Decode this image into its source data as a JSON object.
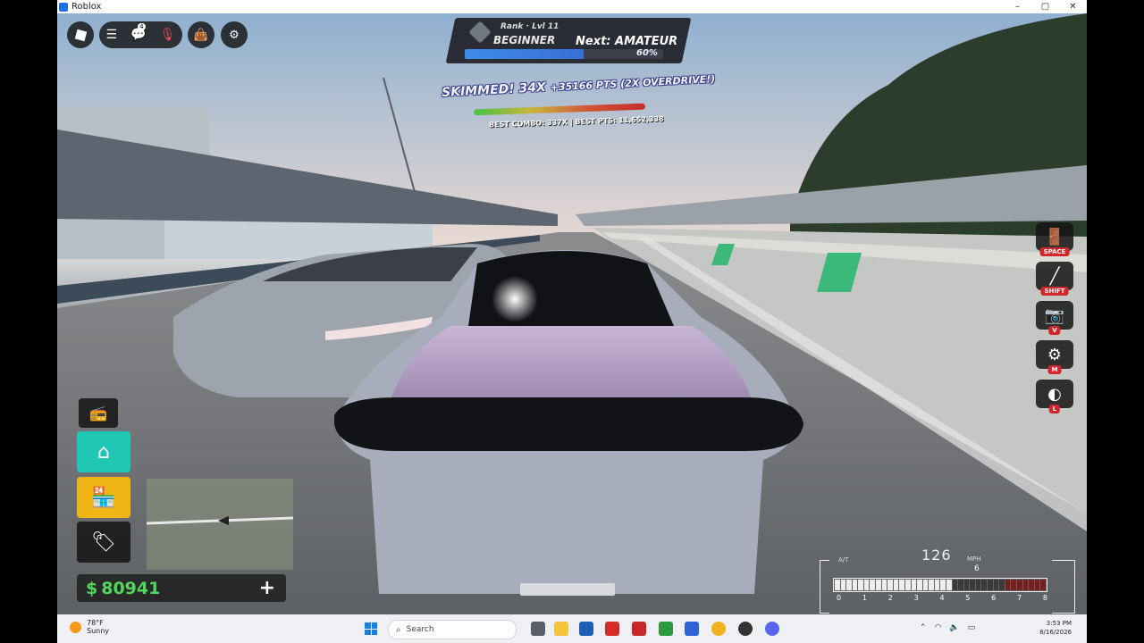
{
  "window": {
    "title": "Roblox",
    "controls": [
      "–",
      "▢",
      "✕"
    ]
  },
  "topbar": {
    "logo_icon": "roblox-logo-icon",
    "menu_icon": "menu-icon",
    "chat_badge": "4",
    "bag_icon": "backpack-icon",
    "gear_icon": "gear-icon"
  },
  "rank": {
    "label": "Rank · Lvl 11",
    "name": "BEGINNER",
    "next": "Next: AMATEUR",
    "progress_percent": 60,
    "progress_text": "60%"
  },
  "skim": {
    "headline": "SKIMMED! 34X",
    "points": "+35166 PTS (2X OVERDRIVE!)",
    "best": "BEST COMBO: 337X | BEST PTS: 11,652,338"
  },
  "side_controls": [
    {
      "name": "exit-vehicle",
      "icon": "door-exit-icon",
      "key": "SPACE"
    },
    {
      "name": "handbrake",
      "icon": "handbrake-icon",
      "key": "SHIFT"
    },
    {
      "name": "camera",
      "icon": "camera-icon",
      "key": "V"
    },
    {
      "name": "transmission",
      "icon": "gear-shift-icon",
      "key": "M"
    },
    {
      "name": "headlights",
      "icon": "headlight-icon",
      "key": "L"
    }
  ],
  "left_menu": {
    "radio_icon": "radio-icon",
    "garage_icon": "garage-icon",
    "shop_icon": "shop-icon",
    "dealer_icon": "dealer-icon"
  },
  "money": {
    "sign": "$",
    "amount": "80941",
    "add": "+"
  },
  "speedometer": {
    "speed": "126",
    "unit": "MPH",
    "gear": "6",
    "transmission": "A/T",
    "ticks": [
      "0",
      "1",
      "2",
      "3",
      "4",
      "5",
      "6",
      "7",
      "8"
    ],
    "rpm_fraction": 0.55
  },
  "taskbar": {
    "weather_temp": "78°F",
    "weather_desc": "Sunny",
    "search_placeholder": "Search",
    "time": "3:53 PM",
    "date": "8/16/2026",
    "tray_icons": [
      "chevron-up-icon",
      "wifi-icon",
      "speaker-icon",
      "battery-icon"
    ]
  }
}
